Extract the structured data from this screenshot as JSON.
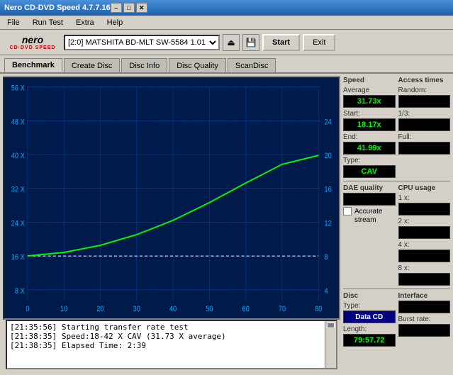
{
  "titlebar": {
    "title": "Nero CD-DVD Speed 4.7.7.16",
    "minimize": "–",
    "maximize": "□",
    "close": "✕"
  },
  "menubar": {
    "items": [
      "File",
      "Run Test",
      "Extra",
      "Help"
    ]
  },
  "toolbar": {
    "logo_text": "nero",
    "logo_sub": "CD•DVD SPEED",
    "drive": "[2:0]  MATSHITA BD-MLT SW-5584 1.01",
    "start_label": "Start",
    "exit_label": "Exit"
  },
  "tabs": {
    "items": [
      "Benchmark",
      "Create Disc",
      "Disc Info",
      "Disc Quality",
      "ScanDisc"
    ],
    "active": "Benchmark"
  },
  "chart": {
    "y_labels_left": [
      "56 X",
      "48 X",
      "40 X",
      "32 X",
      "24 X",
      "16 X",
      "8 X",
      "0"
    ],
    "y_labels_right": [
      "24",
      "20",
      "16",
      "12",
      "8",
      "4"
    ],
    "x_labels": [
      "0",
      "10",
      "20",
      "30",
      "40",
      "50",
      "60",
      "70",
      "80"
    ]
  },
  "speed_panel": {
    "title": "Speed",
    "avg_label": "Average",
    "avg_value": "31.73x",
    "start_label": "Start:",
    "start_value": "18.17x",
    "end_label": "End:",
    "end_value": "41.99x",
    "type_label": "Type:",
    "type_value": "CAV"
  },
  "access_panel": {
    "title": "Access times",
    "random_label": "Random:",
    "onethird_label": "1/3:",
    "full_label": "Full:"
  },
  "cpu_panel": {
    "title": "CPU usage",
    "x1_label": "1 x:",
    "x2_label": "2 x:",
    "x4_label": "4 x:",
    "x8_label": "8 x:"
  },
  "dae_panel": {
    "title": "DAE quality",
    "accurate_label": "Accurate",
    "stream_label": "stream"
  },
  "disc_panel": {
    "title": "Disc",
    "type_label": "Type:",
    "type_value": "Data CD",
    "length_label": "Length:",
    "length_value": "79:57.72",
    "interface_label": "Interface",
    "burst_label": "Burst rate:"
  },
  "log": {
    "lines": [
      "[21:35:56]  Starting transfer rate test",
      "[21:38:35]  Speed:18-42 X CAV (31.73 X average)",
      "[21:38:35]  Elapsed Time: 2:39"
    ]
  }
}
